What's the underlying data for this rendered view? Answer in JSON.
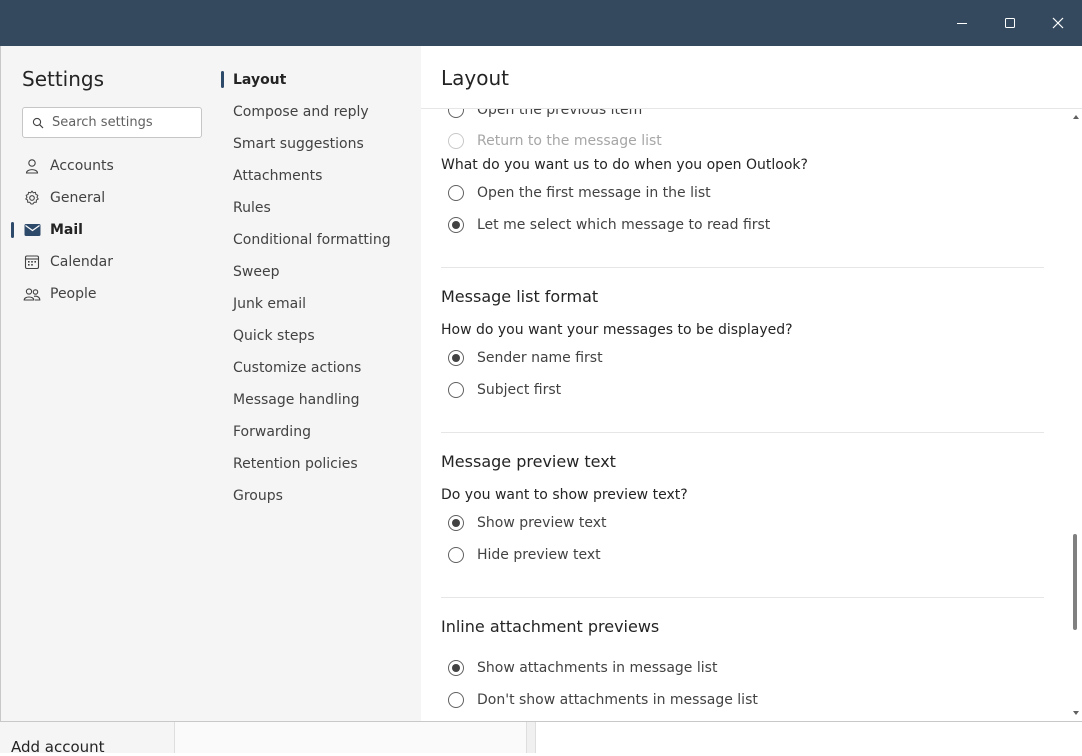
{
  "settings": {
    "title": "Settings",
    "search_placeholder": "Search settings"
  },
  "categories": [
    {
      "label": "Accounts",
      "icon": "person-icon"
    },
    {
      "label": "General",
      "icon": "gear-icon"
    },
    {
      "label": "Mail",
      "icon": "mail-icon",
      "active": true
    },
    {
      "label": "Calendar",
      "icon": "calendar-icon"
    },
    {
      "label": "People",
      "icon": "people-icon"
    }
  ],
  "mail_nav": [
    {
      "label": "Layout",
      "active": true
    },
    {
      "label": "Compose and reply"
    },
    {
      "label": "Smart suggestions"
    },
    {
      "label": "Attachments"
    },
    {
      "label": "Rules"
    },
    {
      "label": "Conditional formatting"
    },
    {
      "label": "Sweep"
    },
    {
      "label": "Junk email"
    },
    {
      "label": "Quick steps"
    },
    {
      "label": "Customize actions"
    },
    {
      "label": "Message handling"
    },
    {
      "label": "Forwarding"
    },
    {
      "label": "Retention policies"
    },
    {
      "label": "Groups"
    }
  ],
  "content": {
    "title": "Layout",
    "partial_options": [
      {
        "label": "Open the previous item",
        "checked": false,
        "disabled": false
      },
      {
        "label": "Return to the message list",
        "checked": false,
        "disabled": true
      }
    ],
    "open_outlook": {
      "question": "What do you want us to do when you open Outlook?",
      "options": [
        {
          "label": "Open the first message in the list",
          "checked": false
        },
        {
          "label": "Let me select which message to read first",
          "checked": true
        }
      ]
    },
    "message_list_format": {
      "title": "Message list format",
      "question": "How do you want your messages to be displayed?",
      "options": [
        {
          "label": "Sender name first",
          "checked": true
        },
        {
          "label": "Subject first",
          "checked": false
        }
      ]
    },
    "message_preview": {
      "title": "Message preview text",
      "question": "Do you want to show preview text?",
      "options": [
        {
          "label": "Show preview text",
          "checked": true
        },
        {
          "label": "Hide preview text",
          "checked": false
        }
      ]
    },
    "inline_attachments": {
      "title": "Inline attachment previews",
      "options": [
        {
          "label": "Show attachments in message list",
          "checked": true
        },
        {
          "label": "Don't show attachments in message list",
          "checked": false
        }
      ]
    }
  },
  "background": {
    "add_account": "Add account"
  },
  "colors": {
    "titlebar": "#34495e",
    "accent": "#2e4a6b"
  }
}
